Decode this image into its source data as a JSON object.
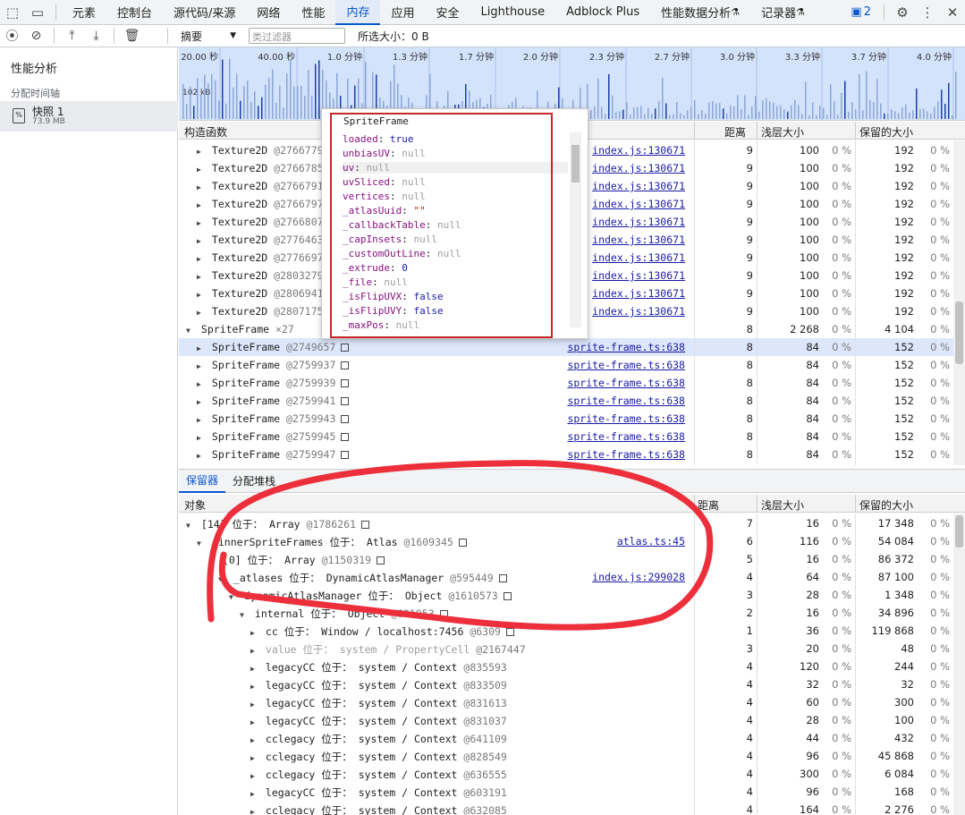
{
  "topbar": {
    "tabs": [
      "元素",
      "控制台",
      "源代码/来源",
      "网络",
      "性能",
      "内存",
      "应用",
      "安全",
      "Lighthouse",
      "Adblock Plus",
      "性能数据分析",
      "记录器"
    ],
    "active_tab": "内存",
    "issues_count": "2"
  },
  "toolbar": {
    "summary_label": "摘要",
    "filter_placeholder": "类过滤器",
    "selected_size": "所选大小：0 B"
  },
  "sidebar": {
    "title": "性能分析",
    "subtitle": "分配时间轴",
    "snapshot_name": "快照 1",
    "snapshot_size": "73.9 MB"
  },
  "timeline": {
    "ticks": [
      "20.00 秒",
      "40.00 秒",
      "1.0 分钟",
      "1.3 分钟",
      "1.7 分钟",
      "2.0 分钟",
      "2.3 分钟",
      "2.7 分钟",
      "3.0 分钟",
      "3.3 分钟",
      "3.7 分钟",
      "4.0 分钟"
    ],
    "y_label": "102 kB"
  },
  "constructors": {
    "headers": {
      "name": "构造函数",
      "distance": "距离",
      "shallow": "浅层大小",
      "retained": "保留的大小"
    },
    "rows": [
      {
        "indent": 1,
        "expand": "▶",
        "name": "Texture2D",
        "id": "@2766779",
        "src": "index.js:130671",
        "dist": "9",
        "shallow": "100",
        "sp": "0 %",
        "retained": "192",
        "rp": "0 %"
      },
      {
        "indent": 1,
        "expand": "▶",
        "name": "Texture2D",
        "id": "@2766785",
        "src": "index.js:130671",
        "dist": "9",
        "shallow": "100",
        "sp": "0 %",
        "retained": "192",
        "rp": "0 %"
      },
      {
        "indent": 1,
        "expand": "▶",
        "name": "Texture2D",
        "id": "@2766791",
        "src": "index.js:130671",
        "dist": "9",
        "shallow": "100",
        "sp": "0 %",
        "retained": "192",
        "rp": "0 %"
      },
      {
        "indent": 1,
        "expand": "▶",
        "name": "Texture2D",
        "id": "@2766797",
        "src": "index.js:130671",
        "dist": "9",
        "shallow": "100",
        "sp": "0 %",
        "retained": "192",
        "rp": "0 %"
      },
      {
        "indent": 1,
        "expand": "▶",
        "name": "Texture2D",
        "id": "@2766807",
        "src": "index.js:130671",
        "dist": "9",
        "shallow": "100",
        "sp": "0 %",
        "retained": "192",
        "rp": "0 %"
      },
      {
        "indent": 1,
        "expand": "▶",
        "name": "Texture2D",
        "id": "@2776463",
        "src": "index.js:130671",
        "dist": "9",
        "shallow": "100",
        "sp": "0 %",
        "retained": "192",
        "rp": "0 %"
      },
      {
        "indent": 1,
        "expand": "▶",
        "name": "Texture2D",
        "id": "@2776697",
        "src": "index.js:130671",
        "dist": "9",
        "shallow": "100",
        "sp": "0 %",
        "retained": "192",
        "rp": "0 %"
      },
      {
        "indent": 1,
        "expand": "▶",
        "name": "Texture2D",
        "id": "@2803279",
        "src": "index.js:130671",
        "dist": "9",
        "shallow": "100",
        "sp": "0 %",
        "retained": "192",
        "rp": "0 %"
      },
      {
        "indent": 1,
        "expand": "▶",
        "name": "Texture2D",
        "id": "@2806941",
        "src": "index.js:130671",
        "dist": "9",
        "shallow": "100",
        "sp": "0 %",
        "retained": "192",
        "rp": "0 %"
      },
      {
        "indent": 1,
        "expand": "▶",
        "name": "Texture2D",
        "id": "@2807175",
        "src": "index.js:130671",
        "dist": "9",
        "shallow": "100",
        "sp": "0 %",
        "retained": "192",
        "rp": "0 %"
      },
      {
        "indent": 0,
        "expand": "▼",
        "name": "SpriteFrame",
        "id": "×27",
        "src": "",
        "dist": "8",
        "shallow": "2 268",
        "sp": "0 %",
        "retained": "4 104",
        "rp": "0 %"
      },
      {
        "indent": 1,
        "expand": "▶",
        "name": "SpriteFrame",
        "id": "@2749657",
        "src": "sprite-frame.ts:638",
        "dist": "8",
        "shallow": "84",
        "sp": "0 %",
        "retained": "152",
        "rp": "0 %",
        "selected": true,
        "box": true
      },
      {
        "indent": 1,
        "expand": "▶",
        "name": "SpriteFrame",
        "id": "@2759937",
        "src": "sprite-frame.ts:638",
        "dist": "8",
        "shallow": "84",
        "sp": "0 %",
        "retained": "152",
        "rp": "0 %",
        "box": true
      },
      {
        "indent": 1,
        "expand": "▶",
        "name": "SpriteFrame",
        "id": "@2759939",
        "src": "sprite-frame.ts:638",
        "dist": "8",
        "shallow": "84",
        "sp": "0 %",
        "retained": "152",
        "rp": "0 %",
        "box": true
      },
      {
        "indent": 1,
        "expand": "▶",
        "name": "SpriteFrame",
        "id": "@2759941",
        "src": "sprite-frame.ts:638",
        "dist": "8",
        "shallow": "84",
        "sp": "0 %",
        "retained": "152",
        "rp": "0 %",
        "box": true
      },
      {
        "indent": 1,
        "expand": "▶",
        "name": "SpriteFrame",
        "id": "@2759943",
        "src": "sprite-frame.ts:638",
        "dist": "8",
        "shallow": "84",
        "sp": "0 %",
        "retained": "152",
        "rp": "0 %",
        "box": true
      },
      {
        "indent": 1,
        "expand": "▶",
        "name": "SpriteFrame",
        "id": "@2759945",
        "src": "sprite-frame.ts:638",
        "dist": "8",
        "shallow": "84",
        "sp": "0 %",
        "retained": "152",
        "rp": "0 %",
        "box": true
      },
      {
        "indent": 1,
        "expand": "▶",
        "name": "SpriteFrame",
        "id": "@2759947",
        "src": "sprite-frame.ts:638",
        "dist": "8",
        "shallow": "84",
        "sp": "0 %",
        "retained": "152",
        "rp": "0 %",
        "box": true
      }
    ]
  },
  "popover": {
    "header": "SpriteFrame",
    "props": [
      {
        "k": "loaded",
        "v": "true",
        "t": "true"
      },
      {
        "k": "unbiasUV",
        "v": "null",
        "t": "null"
      },
      {
        "k": "uv",
        "v": "null",
        "t": "null"
      },
      {
        "k": "uvSliced",
        "v": "null",
        "t": "null"
      },
      {
        "k": "vertices",
        "v": "null",
        "t": "null"
      },
      {
        "k": "_atlasUuid",
        "v": "\"\"",
        "t": "str"
      },
      {
        "k": "_callbackTable",
        "v": "null",
        "t": "null"
      },
      {
        "k": "_capInsets",
        "v": "null",
        "t": "null"
      },
      {
        "k": "_customOutLine",
        "v": "null",
        "t": "null"
      },
      {
        "k": "_extrude",
        "v": "0",
        "t": "true"
      },
      {
        "k": "_file",
        "v": "null",
        "t": "null"
      },
      {
        "k": "_isFlipUVX",
        "v": "false",
        "t": "true"
      },
      {
        "k": "_isFlipUVY",
        "v": "false",
        "t": "true"
      },
      {
        "k": "_maxPos",
        "v": "null",
        "t": "null"
      }
    ]
  },
  "bottom_tabs": {
    "retainers": "保留器",
    "alloc_stack": "分配堆栈"
  },
  "retainers": {
    "headers": {
      "name": "对象",
      "distance": "距离",
      "shallow": "浅层大小",
      "retained": "保留的大小"
    },
    "rows": [
      {
        "indent": 0,
        "expand": "▼",
        "name": "[14]",
        "prefix": "位于：",
        "obj": "Array",
        "id": "@1786261",
        "src": "",
        "dist": "7",
        "shallow": "16",
        "sp": "0 %",
        "retained": "17 348",
        "rp": "0 %",
        "box": true
      },
      {
        "indent": 1,
        "expand": "▼",
        "name": "_innerSpriteFrames",
        "prefix": "位于：",
        "obj": "Atlas",
        "id": "@1609345",
        "src": "atlas.ts:45",
        "dist": "6",
        "shallow": "116",
        "sp": "0 %",
        "retained": "54 084",
        "rp": "0 %",
        "box": true
      },
      {
        "indent": 2,
        "expand": "",
        "name": "[0]",
        "prefix": "位于：",
        "obj": "Array",
        "id": "@1150319",
        "src": "",
        "dist": "5",
        "shallow": "16",
        "sp": "0 %",
        "retained": "86 372",
        "rp": "0 %",
        "box": true
      },
      {
        "indent": 3,
        "expand": "▼",
        "name": "_atlases",
        "prefix": "位于：",
        "obj": "DynamicAtlasManager",
        "id": "@595449",
        "src": "index.js:299028",
        "dist": "4",
        "shallow": "64",
        "sp": "0 %",
        "retained": "87 100",
        "rp": "0 %",
        "box": true
      },
      {
        "indent": 4,
        "expand": "▼",
        "name": "dynamicAtlasManager",
        "prefix": "位于：",
        "obj": "Object",
        "id": "@1610573",
        "src": "",
        "dist": "3",
        "shallow": "28",
        "sp": "0 %",
        "retained": "1 348",
        "rp": "0 %",
        "box": true
      },
      {
        "indent": 5,
        "expand": "▼",
        "name": "internal",
        "prefix": "位于：",
        "obj": "Object",
        "id": "@631953",
        "src": "",
        "dist": "2",
        "shallow": "16",
        "sp": "0 %",
        "retained": "34 896",
        "rp": "0 %",
        "box": true
      },
      {
        "indent": 6,
        "expand": "▶",
        "name": "cc",
        "prefix": "位于：",
        "obj": "Window / localhost:7456",
        "id": "@6309",
        "src": "",
        "dist": "1",
        "shallow": "36",
        "sp": "0 %",
        "retained": "119 868",
        "rp": "0 %",
        "box": true
      },
      {
        "indent": 6,
        "expand": "▶",
        "name": "value",
        "prefix": "位于：",
        "obj": "system / PropertyCell",
        "id": "@2167447",
        "src": "",
        "dist": "3",
        "shallow": "20",
        "sp": "0 %",
        "retained": "48",
        "rp": "0 %",
        "dim": true
      },
      {
        "indent": 6,
        "expand": "▶",
        "name": "legacyCC",
        "prefix": "位于：",
        "obj": "system / Context",
        "id": "@835593",
        "src": "",
        "dist": "4",
        "shallow": "120",
        "sp": "0 %",
        "retained": "244",
        "rp": "0 %"
      },
      {
        "indent": 6,
        "expand": "▶",
        "name": "legacyCC",
        "prefix": "位于：",
        "obj": "system / Context",
        "id": "@833509",
        "src": "",
        "dist": "4",
        "shallow": "32",
        "sp": "0 %",
        "retained": "32",
        "rp": "0 %"
      },
      {
        "indent": 6,
        "expand": "▶",
        "name": "legacyCC",
        "prefix": "位于：",
        "obj": "system / Context",
        "id": "@831613",
        "src": "",
        "dist": "4",
        "shallow": "60",
        "sp": "0 %",
        "retained": "300",
        "rp": "0 %"
      },
      {
        "indent": 6,
        "expand": "▶",
        "name": "legacyCC",
        "prefix": "位于：",
        "obj": "system / Context",
        "id": "@831037",
        "src": "",
        "dist": "4",
        "shallow": "28",
        "sp": "0 %",
        "retained": "100",
        "rp": "0 %"
      },
      {
        "indent": 6,
        "expand": "▶",
        "name": "cclegacy",
        "prefix": "位于：",
        "obj": "system / Context",
        "id": "@641109",
        "src": "",
        "dist": "4",
        "shallow": "44",
        "sp": "0 %",
        "retained": "432",
        "rp": "0 %"
      },
      {
        "indent": 6,
        "expand": "▶",
        "name": "cclegacy",
        "prefix": "位于：",
        "obj": "system / Context",
        "id": "@828549",
        "src": "",
        "dist": "4",
        "shallow": "96",
        "sp": "0 %",
        "retained": "45 868",
        "rp": "0 %"
      },
      {
        "indent": 6,
        "expand": "▶",
        "name": "cclegacy",
        "prefix": "位于：",
        "obj": "system / Context",
        "id": "@636555",
        "src": "",
        "dist": "4",
        "shallow": "300",
        "sp": "0 %",
        "retained": "6 084",
        "rp": "0 %"
      },
      {
        "indent": 6,
        "expand": "▶",
        "name": "legacyCC",
        "prefix": "位于：",
        "obj": "system / Context",
        "id": "@603191",
        "src": "",
        "dist": "4",
        "shallow": "96",
        "sp": "0 %",
        "retained": "168",
        "rp": "0 %"
      },
      {
        "indent": 6,
        "expand": "▶",
        "name": "cclegacy",
        "prefix": "位于：",
        "obj": "system / Context",
        "id": "@632085",
        "src": "",
        "dist": "4",
        "shallow": "164",
        "sp": "0 %",
        "retained": "2 276",
        "rp": "0 %"
      }
    ]
  }
}
